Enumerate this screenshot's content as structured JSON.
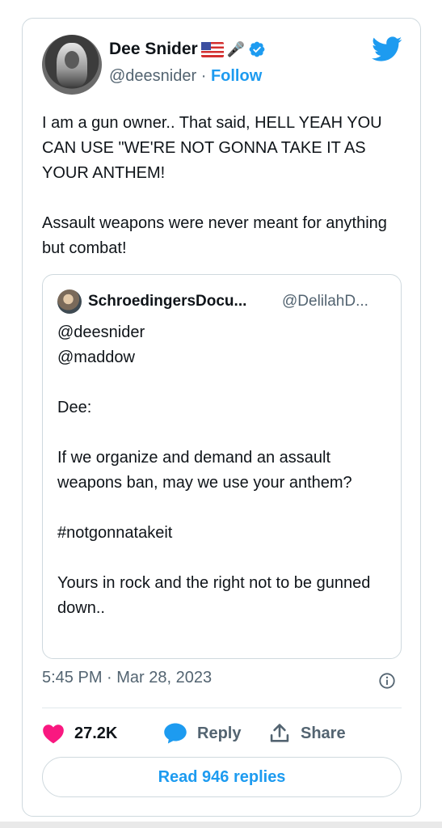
{
  "author": {
    "name": "Dee Snider",
    "handle": "@deesnider",
    "separator": " · ",
    "follow_label": "Follow"
  },
  "icons": {
    "avatar": "profile-photo",
    "flag": "us-flag-emoji",
    "mic": "microphone-emoji",
    "verified": "verified-badge-icon",
    "brand": "twitter-bird-icon",
    "info": "info-circle-icon",
    "like": "heart-icon",
    "reply": "speech-bubble-icon",
    "share": "share-upload-icon"
  },
  "tweet": {
    "text": "I am a gun owner.. That said, HELL YEAH YOU CAN USE \"WE'RE NOT GONNA TAKE IT AS YOUR ANTHEM!\n\nAssault weapons were never meant for anything but combat!",
    "timestamp": "5:45 PM · Mar 28, 2023"
  },
  "quoted": {
    "name": "SchroedingersDocu...",
    "handle": "@DelilahD...",
    "text": "@deesnider\n@maddow\n\nDee:\n\nIf we organize and demand an assault weapons ban, may we use your anthem?\n\n#notgonnatakeit\n\nYours in rock and the right not to be gunned down.."
  },
  "actions": {
    "like_count": "27.2K",
    "reply_label": "Reply",
    "share_label": "Share"
  },
  "read_replies_label": "Read 946 replies",
  "colors": {
    "accent": "#1d9bf0",
    "like": "#f91880",
    "text": "#0f1419",
    "muted": "#536471",
    "border": "#cfd9de"
  }
}
